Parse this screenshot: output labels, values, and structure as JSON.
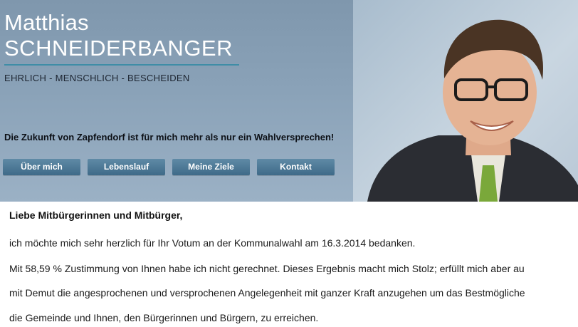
{
  "header": {
    "name_first": "Matthias",
    "name_last": "SCHNEIDERBANGER",
    "slogan": "EHRLICH - MENSCHLICH - BESCHEIDEN",
    "tagline": "Die Zukunft von Zapfendorf ist für mich mehr als nur ein Wahlversprechen!"
  },
  "nav": {
    "items": [
      {
        "label": "Über mich"
      },
      {
        "label": "Lebenslauf"
      },
      {
        "label": "Meine Ziele"
      },
      {
        "label": "Kontakt"
      }
    ]
  },
  "content": {
    "greeting": "Liebe Mitbürgerinnen und Mitbürger,",
    "lines": [
      "ich möchte mich sehr herzlich für Ihr Votum an der Kommunalwahl am 16.3.2014 bedanken.",
      "Mit 58,59 % Zustimmung von Ihnen habe ich nicht gerechnet. Dieses Ergebnis macht mich Stolz; erfüllt mich aber au",
      "mit Demut die angesprochenen und versprochenen Angelegenheit mit ganzer Kraft anzugehen um das Bestmögliche",
      "die Gemeinde und Ihnen, den Bürgerinnen und Bürgern, zu erreichen."
    ]
  },
  "colors": {
    "header_bg": "#8aa2b8",
    "accent_line": "#3f8da6",
    "button_bg": "#4a7593"
  }
}
